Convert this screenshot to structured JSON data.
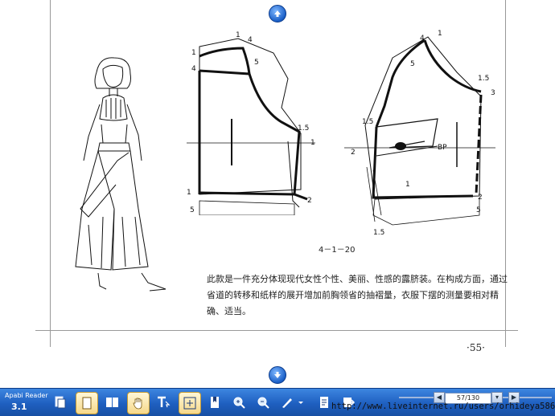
{
  "viewer": {
    "caption_text": "此款是一件充分体现现代女性个性、美丽、性感的露脐装。在构成方面，通过省道的转移和纸样的展开增加前胸领省的抽褶量，衣服下摆的测量要相对精确、适当。",
    "figure_label": "4－1－20",
    "page_number": "·55·",
    "back_labels": {
      "l1": "1",
      "l4a": "4",
      "l1b": "1",
      "l4b": "4",
      "l5": "5",
      "l15": "1.5",
      "l1c": "1",
      "l1d": "1",
      "l2": "2",
      "l5b": "5"
    },
    "front_labels": {
      "l4": "4",
      "l1": "1",
      "l5": "5",
      "l15a": "1.5",
      "l3": "3",
      "l15b": "1.5",
      "bp": "BP",
      "l2": "2",
      "l1b": "1",
      "l2b": "2",
      "l5b": "5",
      "l15c": "1.5"
    }
  },
  "toolbar": {
    "app_name": "Apabi Reader",
    "app_version": "3.1",
    "page_indicator": "57/130",
    "status_url": "http://www.liveinternet.ru/users/orhideya5868/"
  },
  "colors": {
    "toolbar": "#1f5fc0",
    "active_tool": "#f6d88a",
    "nav_arrow": "#1a5fc7"
  }
}
